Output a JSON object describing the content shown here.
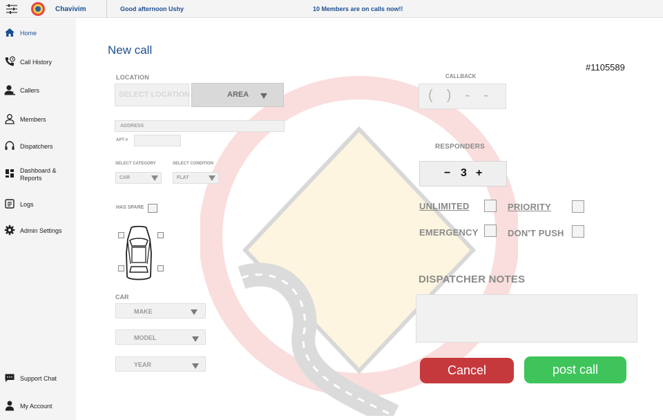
{
  "header": {
    "brand": "Chavivim",
    "greeting": "Good afternoon Ushy",
    "members_msg": "10 Members are on calls now!!"
  },
  "sidebar": {
    "items": [
      {
        "label": "Home",
        "icon": "home-icon"
      },
      {
        "label": "Call History",
        "icon": "call-history-icon"
      },
      {
        "label": "Callers",
        "icon": "callers-icon"
      },
      {
        "label": "Members",
        "icon": "member-icon"
      },
      {
        "label": "Dispatchers",
        "icon": "headset-icon"
      },
      {
        "label": "Dashboard &",
        "label2": "Reports",
        "icon": "dashboard-icon"
      },
      {
        "label": "Logs",
        "icon": "logs-icon"
      },
      {
        "label": "Admin Settings",
        "icon": "gear-icon"
      },
      {
        "label": "Support Chat",
        "icon": "chat-icon"
      },
      {
        "label": "My Account",
        "icon": "account-icon"
      }
    ]
  },
  "form": {
    "title": "New call",
    "call_id": "#1105589",
    "location_label": "LOCATION",
    "location_placeholder": "SELECT LOCATION",
    "area_label": "AREA",
    "address_placeholder": "ADDRESS",
    "apt_label": "APT #",
    "category_label": "SELECT CATEGORY",
    "category_value": "CAR",
    "condition_label": "SELECT CONDITION",
    "condition_value": "FLAT",
    "has_spare_label": "HAS SPARE",
    "car_label": "CAR",
    "make_placeholder": "MAKE",
    "model_placeholder": "MODEL",
    "year_placeholder": "YEAR",
    "callback_label": "CALLBACK",
    "callback_placeholder": "(  )  -  -",
    "responders_label": "RESPONDERS",
    "responders_count": "3",
    "unlimited_label": "UNLIMITED",
    "priority_label": "PRIORITY",
    "emergency_label": "EMERGENCY",
    "dont_push_label": "DON'T PUSH",
    "notes_label": "DISPATCHER NOTES",
    "cancel_label": "Cancel",
    "post_label": "post call"
  },
  "colors": {
    "accent": "#1d4f91",
    "cancel": "#c5393d",
    "post": "#3ec45b",
    "watermark": "#e23b3b"
  }
}
